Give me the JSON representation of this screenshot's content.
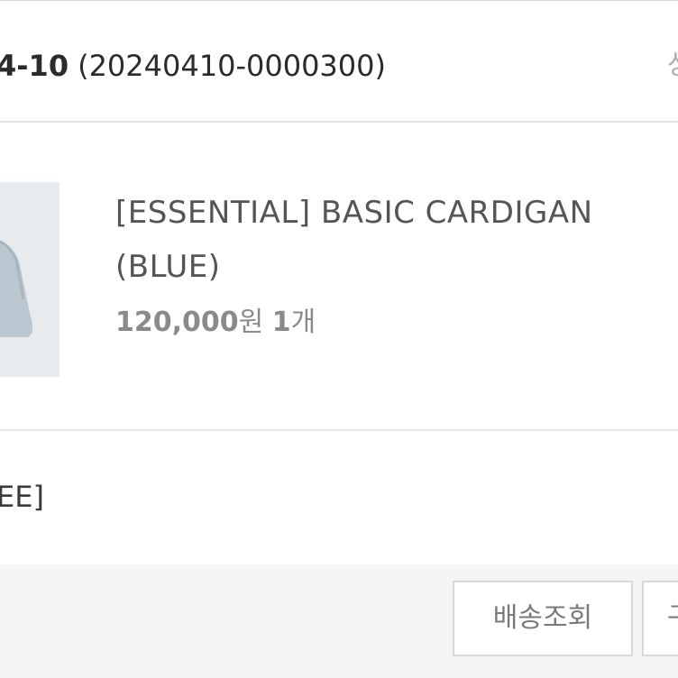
{
  "order": {
    "date": "4-10",
    "number": "(20240410-0000300)",
    "status_partial": "상"
  },
  "product": {
    "name": "[ESSENTIAL] BASIC CARDIGAN (BLUE)",
    "price": "120,000",
    "currency": "원",
    "qty_num": "1",
    "qty_unit": "개",
    "thumbnail_color": "#bac7d1"
  },
  "shipping": {
    "text": "EE]"
  },
  "actions": {
    "track_label": "배송조회",
    "next_label": "구"
  }
}
